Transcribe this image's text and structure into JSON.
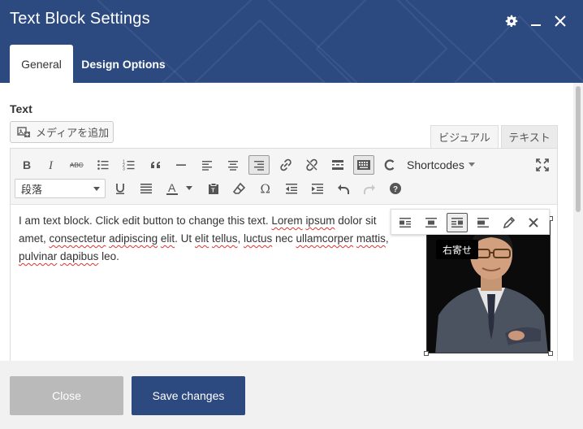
{
  "dialog": {
    "title": "Text Block Settings"
  },
  "tabs": [
    {
      "label": "General",
      "active": true
    },
    {
      "label": "Design Options",
      "active": false
    }
  ],
  "field": {
    "label": "Text",
    "add_media_label": "メディアを追加"
  },
  "editor_modes": {
    "visual": "ビジュアル",
    "text": "テキスト"
  },
  "toolbar": {
    "shortcodes_label": "Shortcodes",
    "format_value": "段落"
  },
  "content": {
    "paragraph_segments": [
      "I am text block. Click edit button to change this text. ",
      "Lorem",
      " ",
      "ipsum",
      " dolor sit amet, ",
      "consectetur",
      " ",
      "adipiscing",
      " ",
      "elit",
      ". Ut ",
      "elit",
      " ",
      "tellus",
      ", ",
      "luctus",
      " nec ",
      "ullamcorper",
      " ",
      "mattis",
      ", ",
      "pulvinar",
      " ",
      "dapibus",
      " leo."
    ],
    "image_tooltip": "右寄せ"
  },
  "footer": {
    "close_label": "Close",
    "save_label": "Save changes"
  },
  "colors": {
    "header_bg": "#2c4a7f",
    "save_bg": "#2c4a7f",
    "close_bg": "#bababa",
    "spellcheck": "#dd3333"
  }
}
